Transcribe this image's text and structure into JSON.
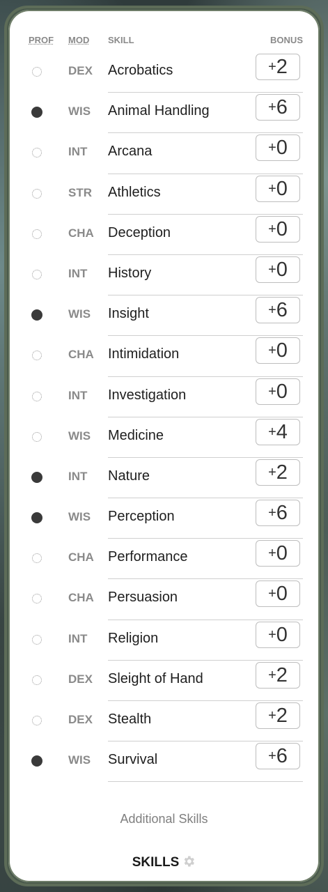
{
  "header": {
    "prof": "PROF",
    "mod": "MOD",
    "skill": "SKILL",
    "bonus": "BONUS"
  },
  "skills": [
    {
      "proficient": false,
      "mod": "DEX",
      "name": "Acrobatics",
      "sign": "+",
      "value": "2"
    },
    {
      "proficient": true,
      "mod": "WIS",
      "name": "Animal Handling",
      "sign": "+",
      "value": "6"
    },
    {
      "proficient": false,
      "mod": "INT",
      "name": "Arcana",
      "sign": "+",
      "value": "0"
    },
    {
      "proficient": false,
      "mod": "STR",
      "name": "Athletics",
      "sign": "+",
      "value": "0"
    },
    {
      "proficient": false,
      "mod": "CHA",
      "name": "Deception",
      "sign": "+",
      "value": "0"
    },
    {
      "proficient": false,
      "mod": "INT",
      "name": "History",
      "sign": "+",
      "value": "0"
    },
    {
      "proficient": true,
      "mod": "WIS",
      "name": "Insight",
      "sign": "+",
      "value": "6"
    },
    {
      "proficient": false,
      "mod": "CHA",
      "name": "Intimidation",
      "sign": "+",
      "value": "0"
    },
    {
      "proficient": false,
      "mod": "INT",
      "name": "Investigation",
      "sign": "+",
      "value": "0"
    },
    {
      "proficient": false,
      "mod": "WIS",
      "name": "Medicine",
      "sign": "+",
      "value": "4"
    },
    {
      "proficient": true,
      "mod": "INT",
      "name": "Nature",
      "sign": "+",
      "value": "2"
    },
    {
      "proficient": true,
      "mod": "WIS",
      "name": "Perception",
      "sign": "+",
      "value": "6"
    },
    {
      "proficient": false,
      "mod": "CHA",
      "name": "Performance",
      "sign": "+",
      "value": "0"
    },
    {
      "proficient": false,
      "mod": "CHA",
      "name": "Persuasion",
      "sign": "+",
      "value": "0"
    },
    {
      "proficient": false,
      "mod": "INT",
      "name": "Religion",
      "sign": "+",
      "value": "0"
    },
    {
      "proficient": false,
      "mod": "DEX",
      "name": "Sleight of Hand",
      "sign": "+",
      "value": "2"
    },
    {
      "proficient": false,
      "mod": "DEX",
      "name": "Stealth",
      "sign": "+",
      "value": "2"
    },
    {
      "proficient": true,
      "mod": "WIS",
      "name": "Survival",
      "sign": "+",
      "value": "6"
    }
  ],
  "additional_label": "Additional Skills",
  "footer": {
    "title": "SKILLS",
    "icon": "gear-icon"
  },
  "colors": {
    "accent_border": "#5d6c58",
    "filled_dot": "#3a3a3a"
  }
}
